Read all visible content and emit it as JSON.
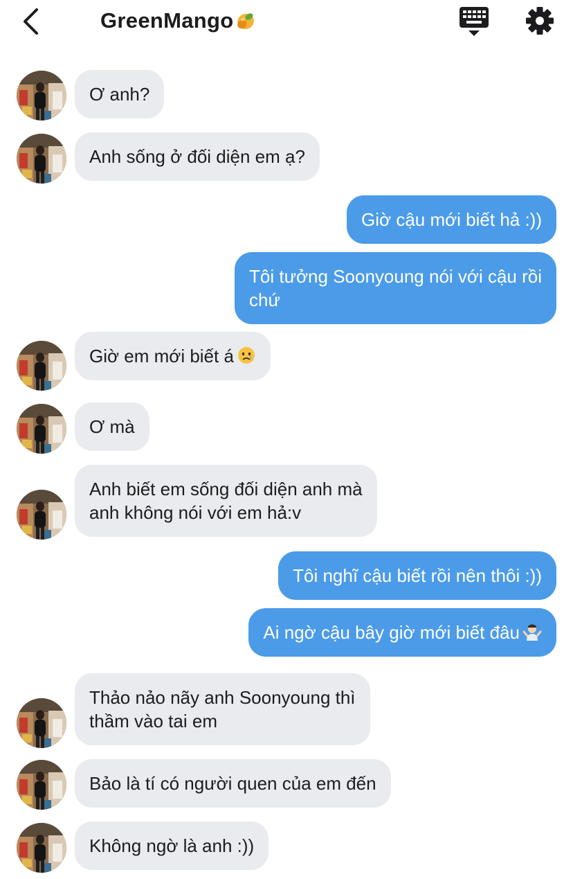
{
  "header": {
    "title": "GreenMango",
    "title_emoji": "mango-emoji-icon",
    "back_icon": "chevron-left-icon",
    "keyboard_icon": "keyboard-icon",
    "settings_icon": "gear-icon"
  },
  "colors": {
    "incoming_bubble": "#e9ebef",
    "outgoing_bubble": "#4b9be8",
    "outgoing_text": "#ffffff",
    "incoming_text": "#1c1c1e"
  },
  "messages": [
    {
      "from": "them",
      "text": "Ơ anh?"
    },
    {
      "from": "them",
      "text": "Anh sống ở đối diện em ạ?"
    },
    {
      "from": "me",
      "text": "Giờ cậu mới biết hả :))"
    },
    {
      "from": "me",
      "text": "Tôi tưởng Soonyoung nói với cậu rồi\nchứ"
    },
    {
      "from": "them",
      "text": "Giờ em mới biết á",
      "emoji": "crying-face-emoji-icon"
    },
    {
      "from": "them",
      "text": "Ơ mà"
    },
    {
      "from": "them",
      "text": "Anh biết em sống đối diện anh mà\nanh không nói với em hả:v"
    },
    {
      "from": "me",
      "text": "Tôi nghĩ cậu biết rồi nên thôi :))"
    },
    {
      "from": "me",
      "text": "Ai ngờ cậu bây giờ mới biết đâu",
      "emoji": "man-shrugging-emoji-icon"
    },
    {
      "from": "them",
      "text": "Thảo nảo nãy anh Soonyoung thì\nthầm vào tai em"
    },
    {
      "from": "them",
      "text": "Bảo là tí có người quen của em đến"
    },
    {
      "from": "them",
      "text": "Không ngờ là anh :))"
    }
  ]
}
